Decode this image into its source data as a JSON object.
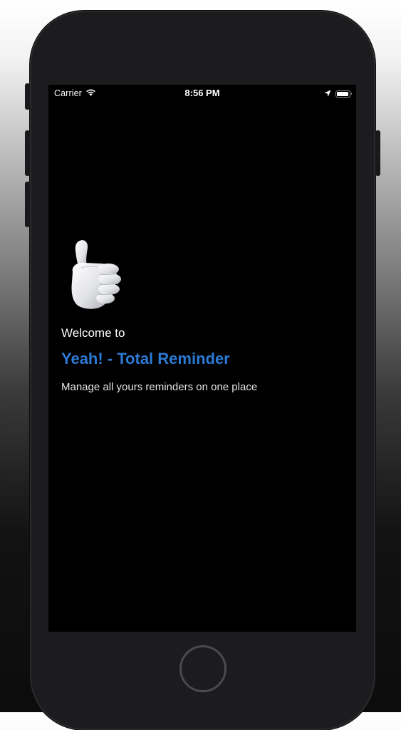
{
  "status_bar": {
    "carrier": "Carrier",
    "time": "8:56 PM",
    "battery_level": 0.95,
    "icons": [
      "wifi-icon",
      "location-arrow-icon",
      "battery-icon"
    ]
  },
  "welcome": {
    "label": "Welcome to",
    "app_name": "Yeah! - Total Reminder",
    "tagline": "Manage all yours reminders on one place",
    "image": "thumbs-up-icon"
  },
  "colors": {
    "accent": "#2c7ad5",
    "screen_bg": "#000000",
    "text": "#ffffff",
    "phone_body": "#1c1c1e"
  },
  "hardware": {
    "home_button": "home-button"
  }
}
